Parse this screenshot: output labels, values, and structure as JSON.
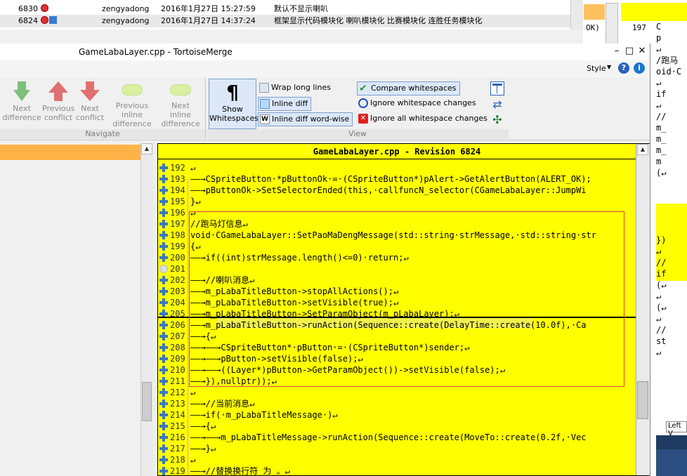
{
  "log": {
    "rows": [
      {
        "rev": "6830",
        "author": "zengyadong",
        "date": "2016年1月27日 15:27:59",
        "message": "默认不显示喇叭"
      },
      {
        "rev": "6824",
        "author": "zengyadong",
        "date": "2016年1月27日 14:37:24",
        "message": "框架显示代码模块化 喇叭模块化 比赛模块化 连胜任务模块化"
      }
    ]
  },
  "background_window": {
    "ok_text": "OK)",
    "line_number": "197",
    "code_lines": [
      "C",
      "p",
      "↵",
      "/跑马",
      "oid·C",
      "↵",
      "if",
      "↵",
      "//",
      "m_",
      "m_",
      "m_",
      "m",
      "(↵",
      "",
      "",
      "",
      "",
      "",
      "})",
      "↵",
      "//",
      "if",
      "(↵",
      "↵",
      "(↵",
      "↵",
      "//",
      "st",
      "↵"
    ],
    "left_view_label": "Left V"
  },
  "window": {
    "title": "GameLabaLayer.cpp - TortoiseMerge",
    "minimize": "–",
    "maximize": "□",
    "close": "✕"
  },
  "menubar": {
    "style_label": "Style",
    "help_icon": "?",
    "info_icon": "i"
  },
  "ribbon": {
    "navigate": {
      "label": "Navigate",
      "next_difference": "Next\ndifference",
      "previous_conflict": "Previous\nconflict",
      "next_conflict": "Next\nconflict",
      "previous_inline_difference": "Previous inline\ndifference",
      "next_inline_difference": "Next inline\ndifference"
    },
    "view": {
      "label": "View",
      "show_whitespaces": "Show\nWhitespaces",
      "wrap_long_lines": "Wrap long lines",
      "inline_diff": "Inline diff",
      "inline_diff_word_wise": "Inline diff word-wise",
      "compare_whitespaces": "Compare whitespaces",
      "ignore_whitespace_changes": "Ignore whitespace changes",
      "ignore_all_whitespace_changes": "Ignore all whitespace changes"
    }
  },
  "right_pane": {
    "header": "GameLabaLayer.cpp - Revision 6824",
    "lines": [
      {
        "num": "192",
        "marker": "plus",
        "text": "↵"
      },
      {
        "num": "193",
        "marker": "plus",
        "text": "——→CSpriteButton·*pButtonOk·=·(CSpriteButton*)pAlert->GetAlertButton(ALERT_OK);"
      },
      {
        "num": "194",
        "marker": "plus",
        "text": "——→pButtonOk->SetSelectorEnded(this,·callfuncN_selector(CGameLabaLayer::JumpWi"
      },
      {
        "num": "195",
        "marker": "plus",
        "text": "}↵"
      },
      {
        "num": "196",
        "marker": "plus",
        "text": "↵"
      },
      {
        "num": "197",
        "marker": "plus",
        "text": "//跑马灯信息↵"
      },
      {
        "num": "198",
        "marker": "plus",
        "text": "void·CGameLabaLayer::SetPaoMaDengMessage(std::string·strMessage,·std::string·str"
      },
      {
        "num": "199",
        "marker": "plus",
        "text": "{↵"
      },
      {
        "num": "200",
        "marker": "plus",
        "text": "——→if((int)strMessage.length()<=0)·return;↵"
      },
      {
        "num": "201",
        "marker": "circle",
        "text": ""
      },
      {
        "num": "202",
        "marker": "plus",
        "text": "——→//喇叭消息↵"
      },
      {
        "num": "203",
        "marker": "plus",
        "text": "——→m_pLabaTitleButton->stopAllActions();↵"
      },
      {
        "num": "204",
        "marker": "plus",
        "text": "——→m_pLabaTitleButton->setVisible(true);↵"
      },
      {
        "num": "205",
        "marker": "plus",
        "text": "——→m_pLabaTitleButton->SetParamObject(m_pLabaLayer);↵"
      },
      {
        "num": "206",
        "marker": "plus",
        "text": "——→m_pLabaTitleButton->runAction(Sequence::create(DelayTime::create(10.0f),·Ca"
      },
      {
        "num": "207",
        "marker": "plus",
        "text": "——→{↵"
      },
      {
        "num": "208",
        "marker": "plus",
        "text": "——→——→CSpriteButton*·pButton·=·(CSpriteButton*)sender;↵"
      },
      {
        "num": "209",
        "marker": "plus",
        "text": "——→——→pButton->setVisible(false);↵"
      },
      {
        "num": "210",
        "marker": "plus",
        "text": "——→——→((Layer*)pButton->GetParamObject())->setVisible(false);↵"
      },
      {
        "num": "211",
        "marker": "plus",
        "text": "——→}),nullptr));↵"
      },
      {
        "num": "212",
        "marker": "plus",
        "text": "↵"
      },
      {
        "num": "213",
        "marker": "plus",
        "text": "——→//当前消息↵"
      },
      {
        "num": "214",
        "marker": "plus",
        "text": "——→if(·m_pLabaTitleMessage·)↵"
      },
      {
        "num": "215",
        "marker": "plus",
        "text": "——→{↵"
      },
      {
        "num": "216",
        "marker": "plus",
        "text": "——→——→m_pLabaTitleMessage->runAction(Sequence::create(MoveTo::create(0.2f,·Vec"
      },
      {
        "num": "217",
        "marker": "plus",
        "text": "——→}↵"
      },
      {
        "num": "218",
        "marker": "plus",
        "text": "↵"
      },
      {
        "num": "219",
        "marker": "plus",
        "text": "——→//替换换行符 为 。↵"
      }
    ]
  },
  "colors": {
    "added_yellow": "#ffff00",
    "left_header_orange": "#ffb347",
    "gutter_plus_blue": "#3a78c0"
  }
}
